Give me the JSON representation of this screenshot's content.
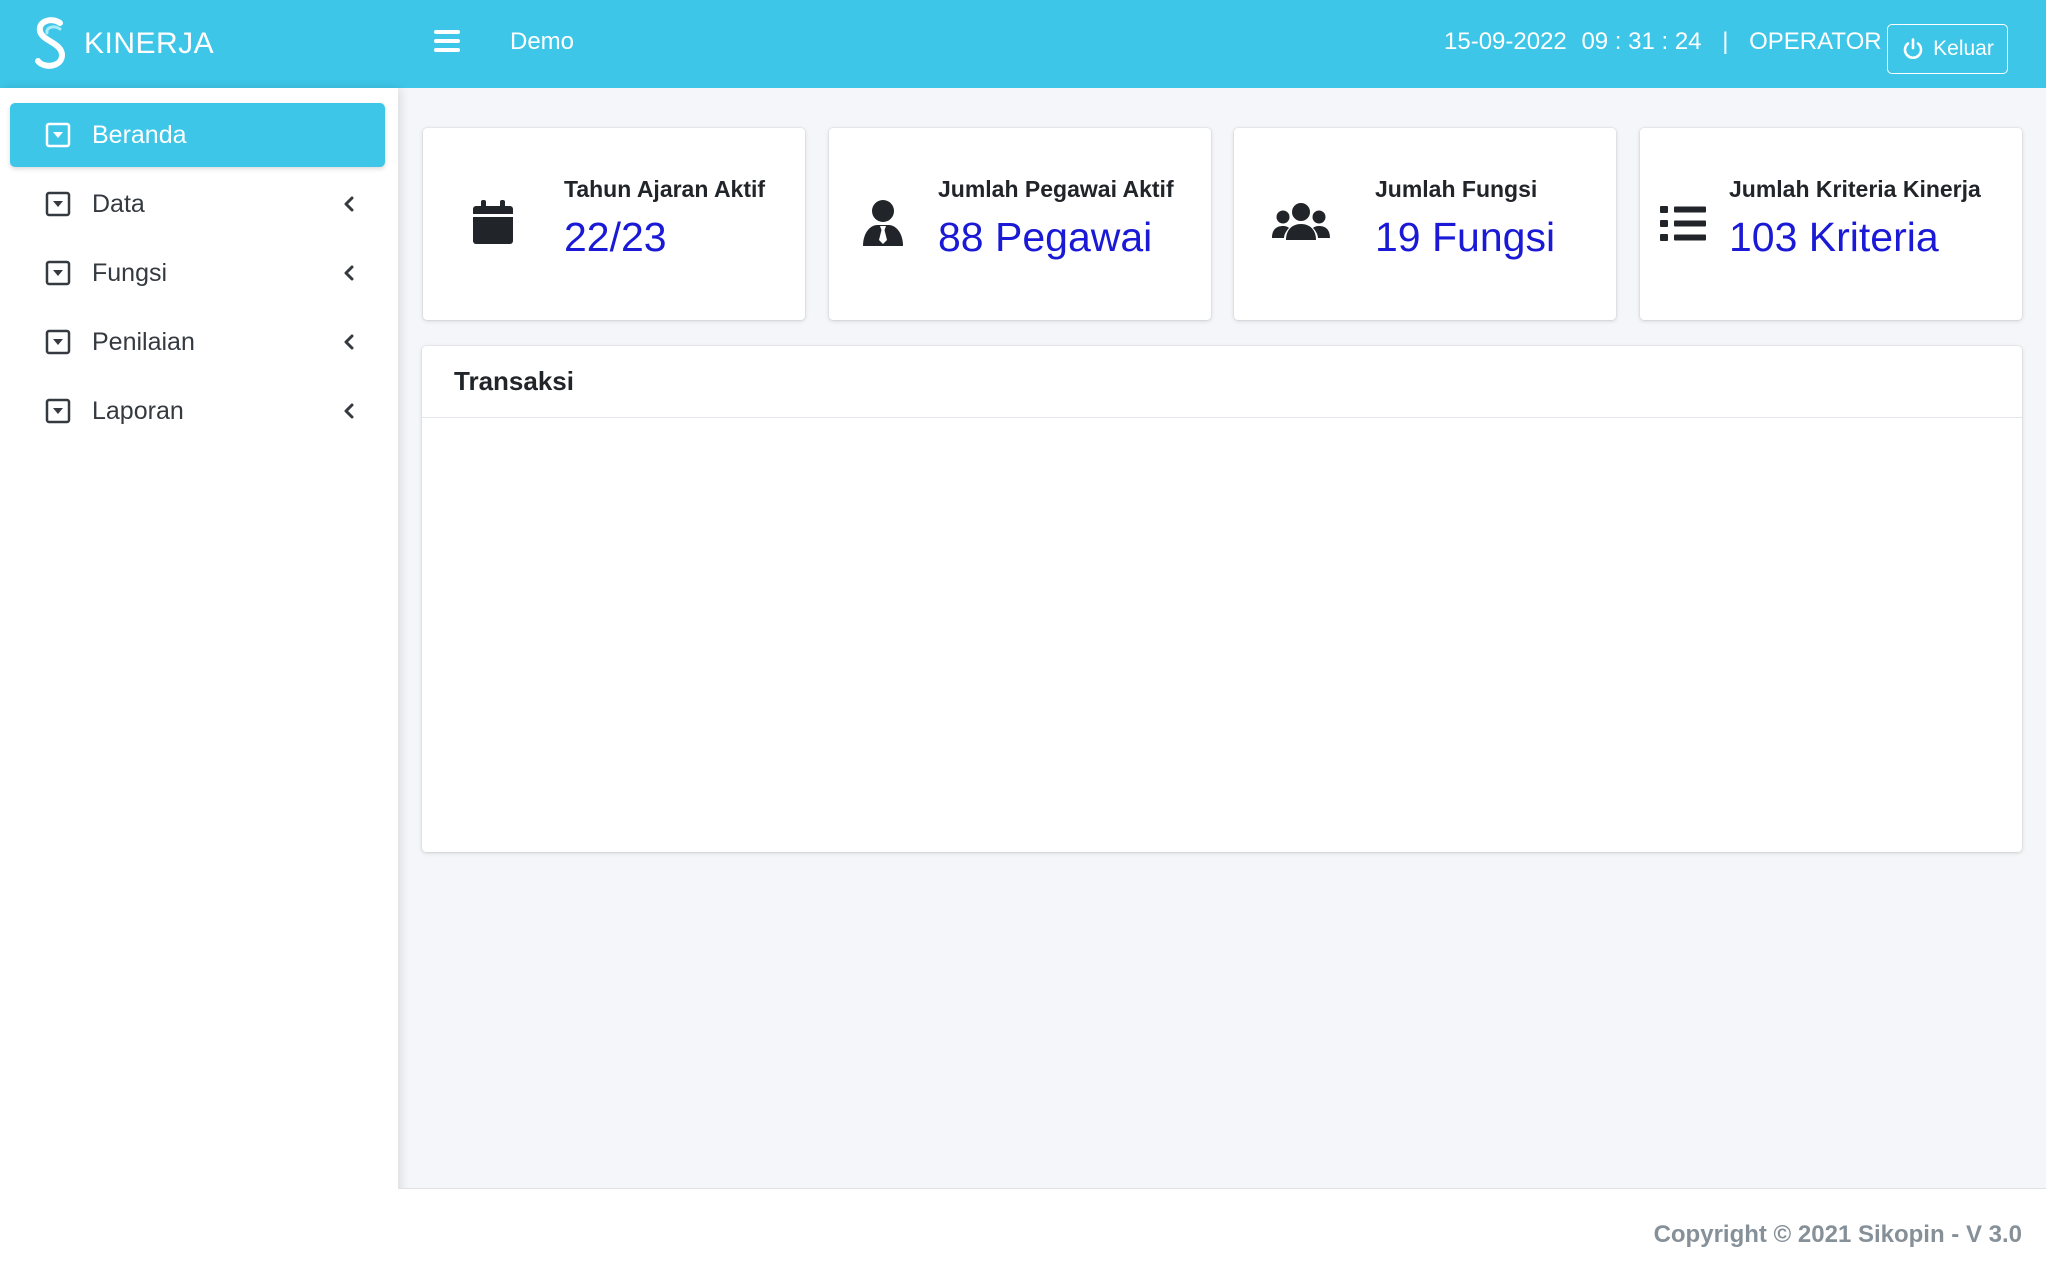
{
  "header": {
    "brand": "KINERJA",
    "school": "Demo",
    "date": "15-09-2022",
    "time": "09 : 31 : 24",
    "separator": "|",
    "role": "OPERATOR",
    "logout_label": "Keluar"
  },
  "sidebar": {
    "items": [
      {
        "label": "Beranda",
        "active": true
      },
      {
        "label": "Data"
      },
      {
        "label": "Fungsi"
      },
      {
        "label": "Penilaian"
      },
      {
        "label": "Laporan"
      }
    ]
  },
  "cards": [
    {
      "label": "Tahun Ajaran Aktif",
      "value": "22/23",
      "icon": "calendar-icon"
    },
    {
      "label": "Jumlah Pegawai Aktif",
      "value": "88 Pegawai",
      "icon": "user-tie-icon"
    },
    {
      "label": "Jumlah Fungsi",
      "value": "19 Fungsi",
      "icon": "users-icon"
    },
    {
      "label": "Jumlah Kriteria Kinerja",
      "value": "103 Kriteria",
      "icon": "list-icon"
    }
  ],
  "panel": {
    "title": "Transaksi"
  },
  "footer": {
    "copyright": "Copyright © 2021 Sikopin - V 3.0"
  },
  "colors": {
    "accent": "#3dc6e8",
    "value_text": "#1a1ad6"
  }
}
